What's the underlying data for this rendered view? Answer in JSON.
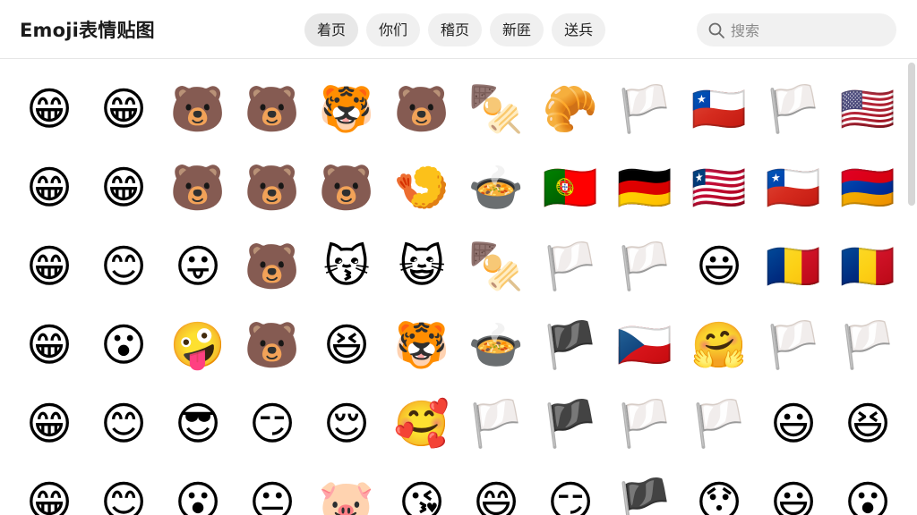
{
  "app": {
    "title": "Emoji表情贴图"
  },
  "tabs": [
    {
      "label": "着页",
      "active": true
    },
    {
      "label": "你们",
      "active": false
    },
    {
      "label": "稽页",
      "active": false
    },
    {
      "label": "新匥",
      "active": false
    },
    {
      "label": "送兵",
      "active": false
    }
  ],
  "search": {
    "placeholder": "搜索",
    "value": ""
  },
  "grid": {
    "rows": [
      [
        "😁",
        "😁",
        "🐻",
        "🐻",
        "🐯",
        "🐻",
        "🍢",
        "🥐",
        "🏳️",
        "🇨🇱",
        "🏳️",
        "🇺🇸"
      ],
      [
        "😁",
        "😁",
        "🐻",
        "🐻",
        "🐻",
        "🍤",
        "🍲",
        "🇵🇹",
        "🇩🇪",
        "🇱🇷",
        "🇨🇱",
        "🇦🇲"
      ],
      [
        "😁",
        "😊",
        "😛",
        "🐻",
        "😽",
        "😺",
        "🍢",
        "🏳️",
        "🏳️",
        "😃",
        "🇷🇴",
        "🇷🇴"
      ],
      [
        "😁",
        "😮",
        "🤪",
        "🐻",
        "😆",
        "🐯",
        "🍲",
        "🏴",
        "🇨🇿",
        "🤗",
        "🏳️",
        "🏳️"
      ],
      [
        "😁",
        "😊",
        "😎",
        "😏",
        "😌",
        "🥰",
        "🏳️",
        "🏴",
        "🏳️",
        "🏳️",
        "😃",
        "😆"
      ],
      [
        "😁",
        "😊",
        "😮",
        "😐",
        "🐷",
        "😘",
        "😄",
        "😏",
        "🏴",
        "😯",
        "😃",
        "😮"
      ]
    ]
  }
}
